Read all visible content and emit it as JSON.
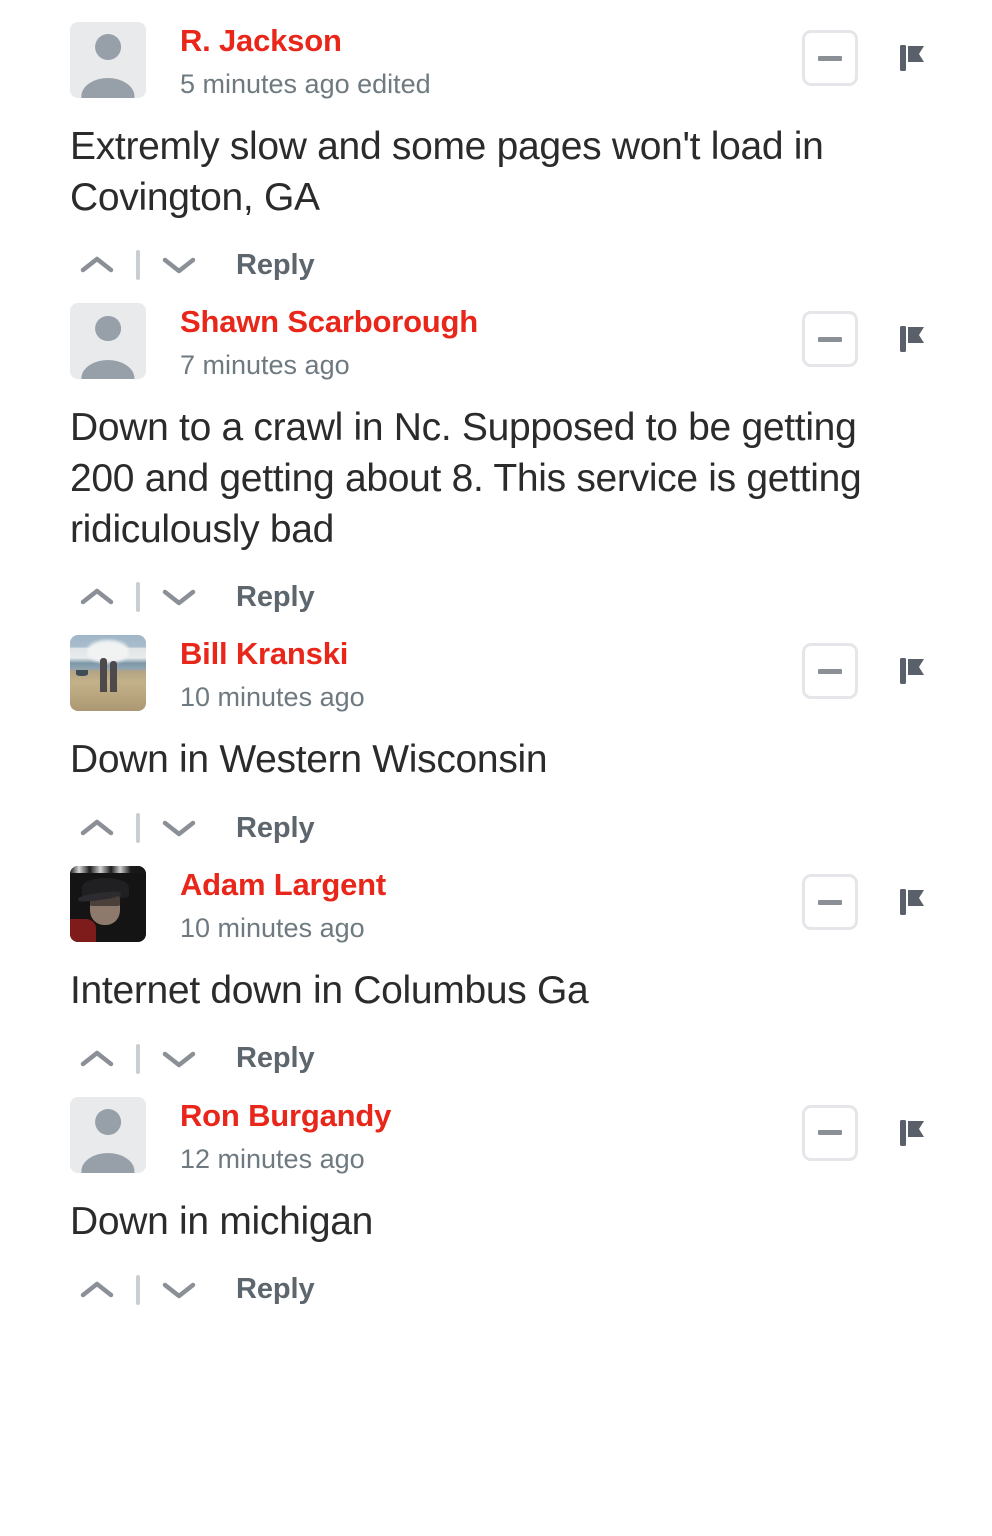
{
  "theme": {
    "author_name_color": "#e8261a",
    "timestamp_color": "#6e7a80",
    "body_text_color": "#2b2b2b",
    "reply_color": "#5e666d",
    "background": "#ffffff"
  },
  "actions": {
    "collapse_label": "collapse-comment",
    "flag_label": "report-comment",
    "upvote_label": "upvote",
    "downvote_label": "downvote",
    "reply_label": "Reply"
  },
  "comments": [
    {
      "author": "R. Jackson",
      "timestamp": "5 minutes ago edited",
      "body": "Extremly slow and some pages won't load in Covington, GA",
      "avatar_type": "placeholder"
    },
    {
      "author": "Shawn Scarborough",
      "timestamp": "7 minutes ago",
      "body": "Down to a crawl in Nc. Supposed to be getting 200 and getting about 8. This service is getting ridiculously bad",
      "avatar_type": "photo-beach"
    },
    {
      "author": "Bill Kranski",
      "timestamp": "10 minutes ago",
      "body": "Down in Western Wisconsin",
      "avatar_type": "photo-beach"
    },
    {
      "author": "Adam Largent",
      "timestamp": "10 minutes ago",
      "body": "Internet down in Columbus Ga",
      "avatar_type": "photo-portrait"
    },
    {
      "author": "Ron Burgandy",
      "timestamp": "12 minutes ago",
      "body": "Down in michigan",
      "avatar_type": "placeholder"
    }
  ]
}
